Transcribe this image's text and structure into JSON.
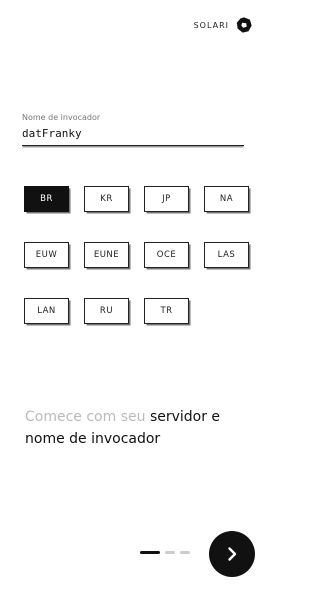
{
  "brand": {
    "name": "SOLARI",
    "logo_icon": "solari-logo-icon"
  },
  "summoner_field": {
    "label": "Nome de invocador",
    "value": "datFranky"
  },
  "servers": [
    {
      "label": "BR",
      "selected": true
    },
    {
      "label": "KR",
      "selected": false
    },
    {
      "label": "JP",
      "selected": false
    },
    {
      "label": "NA",
      "selected": false
    },
    {
      "label": "EUW",
      "selected": false
    },
    {
      "label": "EUNE",
      "selected": false
    },
    {
      "label": "OCE",
      "selected": false
    },
    {
      "label": "LAS",
      "selected": false
    },
    {
      "label": "LAN",
      "selected": false
    },
    {
      "label": "RU",
      "selected": false
    },
    {
      "label": "TR",
      "selected": false
    }
  ],
  "tagline": {
    "muted": "Comece com seu",
    "emphasis": "servidor e nome de invocador"
  },
  "pagination": {
    "current": 1,
    "total": 3
  },
  "next_button": {
    "icon": "chevron-right-icon"
  },
  "colors": {
    "primary": "#111111",
    "muted": "#bbbbbb",
    "background": "#ffffff"
  }
}
